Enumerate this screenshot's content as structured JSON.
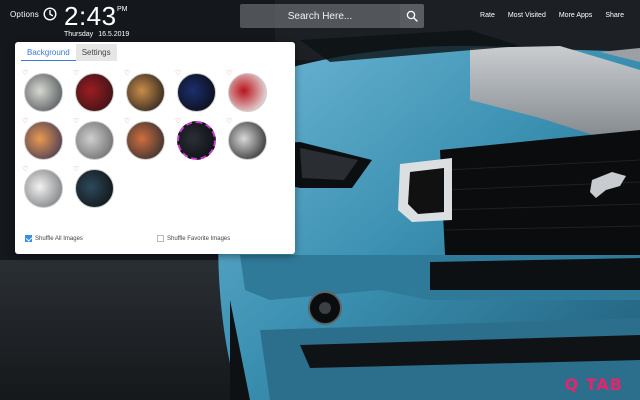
{
  "topbar": {
    "options_label": "Options",
    "time": "2:43",
    "ampm": "PM",
    "weekday": "Thursday",
    "date": "16.5.2019",
    "search_placeholder": "Search Here...",
    "links": [
      "Rate",
      "Most Visited",
      "More Apps",
      "Share"
    ]
  },
  "panel": {
    "tabs": [
      "Background",
      "Settings"
    ],
    "active_tab": "Background",
    "thumbnails": [
      {
        "name": "thumb-classic-silver",
        "colors": [
          "#d8d8d0",
          "#545a5e"
        ]
      },
      {
        "name": "thumb-red-mustang",
        "colors": [
          "#9b1d22",
          "#3a1316"
        ]
      },
      {
        "name": "thumb-desert-mustang",
        "colors": [
          "#c98d48",
          "#2c2420"
        ]
      },
      {
        "name": "thumb-blue-mustang",
        "colors": [
          "#1c2f6e",
          "#0b0d16"
        ]
      },
      {
        "name": "thumb-red-white-stripes",
        "colors": [
          "#b8141c",
          "#e8e8e8"
        ]
      },
      {
        "name": "thumb-sunset-mustang",
        "colors": [
          "#e79a52",
          "#4a3a52"
        ]
      },
      {
        "name": "thumb-silver-lot",
        "colors": [
          "#cfcfcf",
          "#6c6c6c"
        ]
      },
      {
        "name": "thumb-sunset-road",
        "colors": [
          "#cf6e3e",
          "#353030"
        ]
      },
      {
        "name": "thumb-dark-selected",
        "colors": [
          "#2b3038",
          "#0d0f12"
        ]
      },
      {
        "name": "thumb-silver-drift",
        "colors": [
          "#d8d8d8",
          "#303030"
        ]
      },
      {
        "name": "thumb-white-mustang",
        "colors": [
          "#f2f2f2",
          "#7c7e80"
        ]
      },
      {
        "name": "thumb-blue-hood",
        "colors": [
          "#2d4a5c",
          "#111417"
        ]
      }
    ],
    "shuffle_all_label": "Shuffle All Images",
    "shuffle_favorites_label": "Shuffle Favorite Images",
    "shuffle_all_checked": true,
    "shuffle_favorites_checked": false
  },
  "brand": "Q TAB",
  "colors": {
    "accent": "#3a7bd5",
    "brand": "#e5246c",
    "car_body": "#3a8fb0"
  }
}
